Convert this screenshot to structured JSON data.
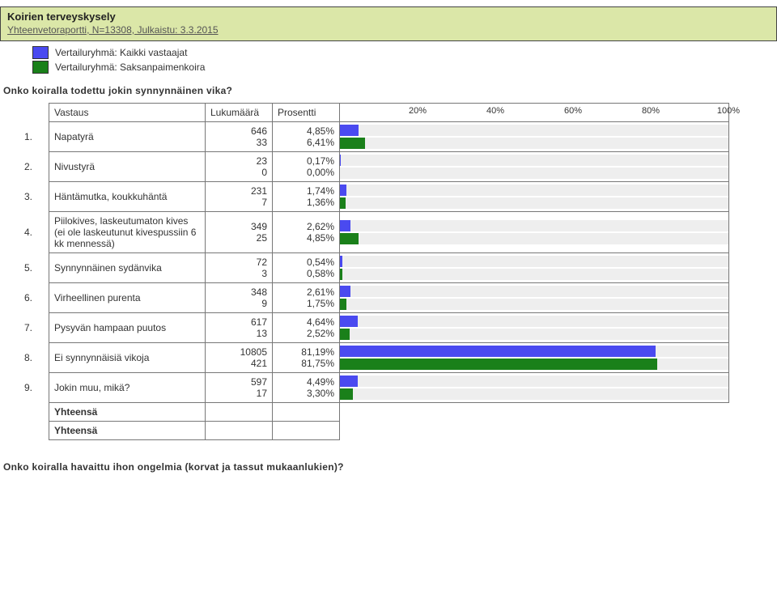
{
  "header": {
    "title": "Koirien terveyskysely",
    "subtitle": "Yhteenvetoraportti, N=13308, Julkaistu: 3.3.2015"
  },
  "legend": {
    "a": "Vertailuryhmä: Kaikki vastaajat",
    "b": "Vertailuryhmä: Saksanpaimenkoira"
  },
  "question": "Onko koiralla todettu jokin synnynnäinen vika?",
  "columns": {
    "answer": "Vastaus",
    "count": "Lukumäärä",
    "percent": "Prosentti"
  },
  "axis_ticks": [
    "20%",
    "40%",
    "60%",
    "80%",
    "100%"
  ],
  "totals_label": "Yhteensä",
  "footer_question": "Onko koiralla havaittu ihon ongelmia (korvat ja tassut mukaanlukien)?",
  "rows": [
    {
      "n": "1.",
      "label": "Napatyrä",
      "c1": "646",
      "p1": "4,85%",
      "c2": "33",
      "p2": "6,41%",
      "v1": 4.85,
      "v2": 6.41
    },
    {
      "n": "2.",
      "label": "Nivustyrä",
      "c1": "23",
      "p1": "0,17%",
      "c2": "0",
      "p2": "0,00%",
      "v1": 0.17,
      "v2": 0.0
    },
    {
      "n": "3.",
      "label": "Häntämutka, koukkuhäntä",
      "c1": "231",
      "p1": "1,74%",
      "c2": "7",
      "p2": "1,36%",
      "v1": 1.74,
      "v2": 1.36
    },
    {
      "n": "4.",
      "label": "Piilokives, laskeutumaton kives (ei ole laskeutunut kivespussiin 6 kk mennessä)",
      "c1": "349",
      "p1": "2,62%",
      "c2": "25",
      "p2": "4,85%",
      "v1": 2.62,
      "v2": 4.85
    },
    {
      "n": "5.",
      "label": "Synnynnäinen sydänvika",
      "c1": "72",
      "p1": "0,54%",
      "c2": "3",
      "p2": "0,58%",
      "v1": 0.54,
      "v2": 0.58
    },
    {
      "n": "6.",
      "label": "Virheellinen purenta",
      "c1": "348",
      "p1": "2,61%",
      "c2": "9",
      "p2": "1,75%",
      "v1": 2.61,
      "v2": 1.75
    },
    {
      "n": "7.",
      "label": "Pysyvän hampaan puutos",
      "c1": "617",
      "p1": "4,64%",
      "c2": "13",
      "p2": "2,52%",
      "v1": 4.64,
      "v2": 2.52
    },
    {
      "n": "8.",
      "label": "Ei synnynnäisiä vikoja",
      "c1": "10805",
      "p1": "81,19%",
      "c2": "421",
      "p2": "81,75%",
      "v1": 81.19,
      "v2": 81.75
    },
    {
      "n": "9.",
      "label": "Jokin muu, mikä?",
      "c1": "597",
      "p1": "4,49%",
      "c2": "17",
      "p2": "3,30%",
      "v1": 4.49,
      "v2": 3.3
    }
  ],
  "chart_data": {
    "type": "bar",
    "title": "Onko koiralla todettu jokin synnynnäinen vika?",
    "xlabel": "Prosentti",
    "ylabel": "Vastaus",
    "xlim": [
      0,
      100
    ],
    "categories": [
      "Napatyrä",
      "Nivustyrä",
      "Häntämutka, koukkuhäntä",
      "Piilokives, laskeutumaton kives (ei ole laskeutunut kivespussiin 6 kk mennessä)",
      "Synnynnäinen sydänvika",
      "Virheellinen purenta",
      "Pysyvän hampaan puutos",
      "Ei synnynnäisiä vikoja",
      "Jokin muu, mikä?"
    ],
    "series": [
      {
        "name": "Kaikki vastaajat",
        "values": [
          4.85,
          0.17,
          1.74,
          2.62,
          0.54,
          2.61,
          4.64,
          81.19,
          4.49
        ]
      },
      {
        "name": "Saksanpaimenkoira",
        "values": [
          6.41,
          0.0,
          1.36,
          4.85,
          0.58,
          1.75,
          2.52,
          81.75,
          3.3
        ]
      }
    ]
  }
}
